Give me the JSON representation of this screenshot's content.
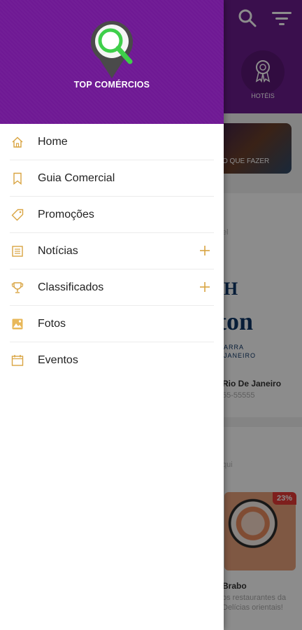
{
  "app": {
    "brand_name": "TOP COMÉRCIOS"
  },
  "background": {
    "category_label": "HOTÉIS",
    "banner_text": "O QUE FAZER",
    "listing_title": "Rio De Janeiro",
    "listing_phone": "55-55555",
    "hilton_word": "ton",
    "hilton_sub_line1": "ARRA",
    "hilton_sub_line2": "JANEIRO",
    "faint_label_1": "el",
    "faint_label_2": "qui",
    "promo_badge": "23%",
    "promo_title": "Brabo",
    "promo_desc_line1": "os restaurantes da",
    "promo_desc_line2": "Delícias orientais!"
  },
  "menu": {
    "items": [
      {
        "label": "Home",
        "icon": "home-icon",
        "expandable": false
      },
      {
        "label": "Guia Comercial",
        "icon": "bookmark-icon",
        "expandable": false
      },
      {
        "label": "Promoções",
        "icon": "tag-icon",
        "expandable": false
      },
      {
        "label": "Notícias",
        "icon": "newspaper-icon",
        "expandable": true
      },
      {
        "label": "Classificados",
        "icon": "trophy-icon",
        "expandable": true
      },
      {
        "label": "Fotos",
        "icon": "photo-icon",
        "expandable": false
      },
      {
        "label": "Eventos",
        "icon": "calendar-icon",
        "expandable": false
      }
    ]
  },
  "colors": {
    "brand_purple": "#6f1994",
    "accent_green": "#3ecf4a",
    "icon_gold": "#d9a441"
  }
}
